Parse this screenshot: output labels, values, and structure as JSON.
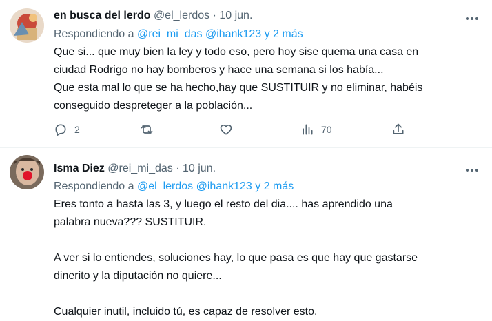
{
  "tweets": [
    {
      "name": "en busca del lerdo",
      "handle": "@el_lerdos",
      "separator": "·",
      "date": "10 jun.",
      "reply_prefix": "Respondiendo a",
      "reply_mentions": "@rei_mi_das @ihank123 y 2 más",
      "lines": [
        "Que si... que muy bien la ley y todo eso, pero hoy sise quema una casa en",
        "ciudad Rodrigo no hay bomberos y hace una semana si los había...",
        "Que esta mal lo que se ha hecho,hay que SUSTITUIR y no eliminar, habéis",
        "conseguido despreteger a la población..."
      ],
      "actions": {
        "reply_count": "2",
        "retweet_count": "",
        "like_count": "",
        "view_count": "70"
      }
    },
    {
      "name": "Isma Diez",
      "handle": "@rei_mi_das",
      "separator": "·",
      "date": "10 jun.",
      "reply_prefix": "Respondiendo a",
      "reply_mentions": "@el_lerdos @ihank123 y 2 más",
      "lines": [
        "Eres tonto a hasta las 3, y luego el resto del dia.... has aprendido una",
        "palabra nueva??? SUSTITUIR.",
        "",
        "A ver si lo entiendes, soluciones hay, lo que pasa es que hay que gastarse",
        "dinerito y la diputación no quiere...",
        "",
        "Cualquier inutil, incluido tú, es capaz de resolver esto."
      ]
    }
  ],
  "colors": {
    "text": "#0f1419",
    "secondary": "#536471",
    "accent": "#1d9bf0",
    "divider": "#eff3f4"
  },
  "icons": [
    "more-icon",
    "reply-icon",
    "retweet-icon",
    "like-icon",
    "views-icon",
    "share-icon"
  ]
}
